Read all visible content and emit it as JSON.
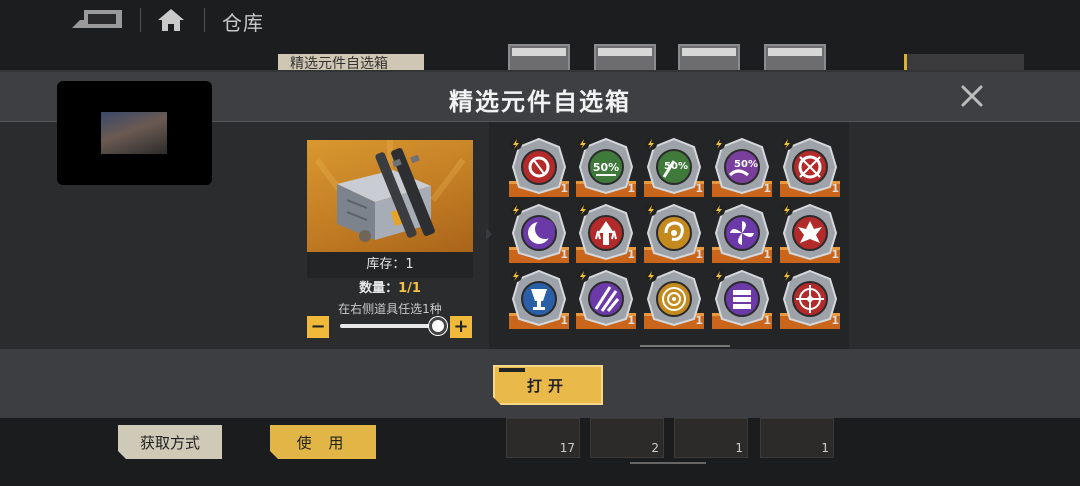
{
  "header": {
    "title": "仓库"
  },
  "background": {
    "tag_label": "精选元件自选箱",
    "acquire_label": "获取方式",
    "use_label": "使 用",
    "slots": [
      {
        "count": "17"
      },
      {
        "count": "2"
      },
      {
        "count": "1"
      },
      {
        "count": "1"
      }
    ]
  },
  "modal": {
    "title": "精选元件自选箱",
    "stock_label": "库存：",
    "stock_value": "1",
    "qty_label": "数量：",
    "qty_value": "1/1",
    "hint": "在右侧道具任选1种",
    "minus_label": "−",
    "plus_label": "+",
    "open_label": "打开",
    "slider_fraction": 1.0
  },
  "components": [
    {
      "icon": "cracked-target-icon",
      "color": "#b22a2a",
      "count": "1"
    },
    {
      "icon": "percent-50-icon",
      "color": "#3f7a3a",
      "count": "1"
    },
    {
      "icon": "percent-50-arrow-icon",
      "color": "#3f7a3a",
      "count": "1"
    },
    {
      "icon": "percent-50-hand-icon",
      "color": "#7a3f9c",
      "count": "1"
    },
    {
      "icon": "crossed-target-icon",
      "color": "#b22a2a",
      "count": "1"
    },
    {
      "icon": "moon-icon",
      "color": "#6b3aa8",
      "count": "1"
    },
    {
      "icon": "up-arrows-icon",
      "color": "#b22a2a",
      "count": "1"
    },
    {
      "icon": "swirl-icon",
      "color": "#c48a1e",
      "count": "1"
    },
    {
      "icon": "fan-icon",
      "color": "#6b3aa8",
      "count": "1"
    },
    {
      "icon": "explosion-icon",
      "color": "#b22a2a",
      "count": "1"
    },
    {
      "icon": "chalice-icon",
      "color": "#2a5fa8",
      "count": "1"
    },
    {
      "icon": "claw-icon",
      "color": "#6b3aa8",
      "count": "1"
    },
    {
      "icon": "rings-icon",
      "color": "#c48a1e",
      "count": "1"
    },
    {
      "icon": "stacked-bars-icon",
      "color": "#6b3aa8",
      "count": "1"
    },
    {
      "icon": "crosshair-icon",
      "color": "#b22a2a",
      "count": "1"
    }
  ]
}
